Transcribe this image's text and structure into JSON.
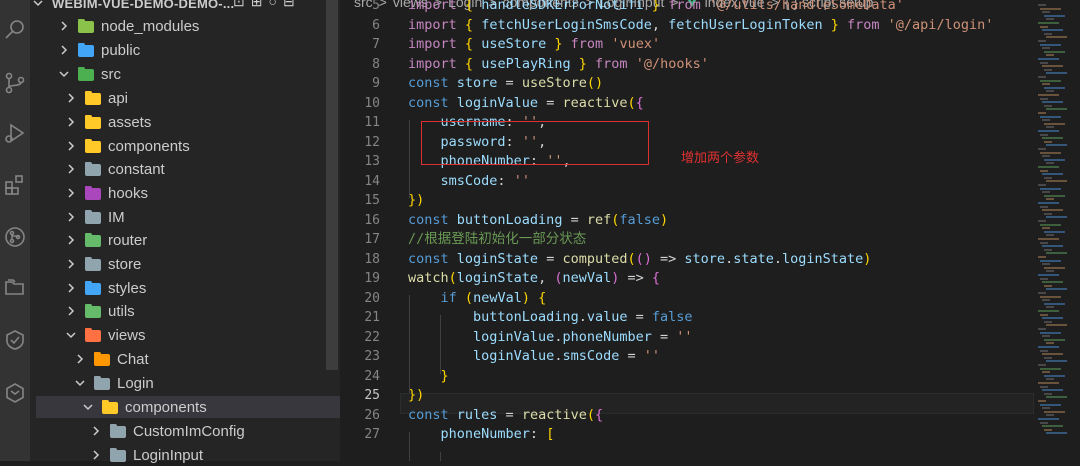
{
  "explorer": {
    "title": "WEBIM-VUE-DEMO-DEMO-...",
    "tree": [
      {
        "label": "node_modules",
        "icon": "node-modules-folder-icon",
        "expanded": false,
        "color": "#8bc34a"
      },
      {
        "label": "public",
        "icon": "public-folder-icon",
        "expanded": false,
        "color": "#42a5f5"
      },
      {
        "label": "src",
        "icon": "src-folder-icon",
        "expanded": true,
        "color": "#4caf50"
      },
      {
        "label": "api",
        "icon": "api-folder-icon",
        "expanded": false,
        "color": "#ffca28"
      },
      {
        "label": "assets",
        "icon": "assets-folder-icon",
        "expanded": false,
        "color": "#ffca28"
      },
      {
        "label": "components",
        "icon": "components-folder-icon",
        "expanded": false,
        "color": "#ffca28"
      },
      {
        "label": "constant",
        "icon": "constant-folder-icon",
        "expanded": false,
        "color": "#90a4ae"
      },
      {
        "label": "hooks",
        "icon": "hooks-folder-icon",
        "expanded": false,
        "color": "#ab47bc"
      },
      {
        "label": "IM",
        "icon": "folder-icon",
        "expanded": false,
        "color": "#90a4ae"
      },
      {
        "label": "router",
        "icon": "router-folder-icon",
        "expanded": false,
        "color": "#66bb6a"
      },
      {
        "label": "store",
        "icon": "store-folder-icon",
        "expanded": false,
        "color": "#90a4ae"
      },
      {
        "label": "styles",
        "icon": "styles-folder-icon",
        "expanded": false,
        "color": "#42a5f5"
      },
      {
        "label": "utils",
        "icon": "utils-folder-icon",
        "expanded": false,
        "color": "#66bb6a"
      },
      {
        "label": "views",
        "icon": "views-folder-icon",
        "expanded": true,
        "color": "#ff7043"
      },
      {
        "label": "Chat",
        "icon": "folder-icon",
        "expanded": false,
        "color": "#ff9800"
      },
      {
        "label": "Login",
        "icon": "folder-icon",
        "expanded": true,
        "color": "#90a4ae"
      },
      {
        "label": "components",
        "icon": "components-folder-icon",
        "expanded": true,
        "color": "#ffca28"
      },
      {
        "label": "CustomImConfig",
        "icon": "folder-icon",
        "expanded": false,
        "color": "#90a4ae"
      },
      {
        "label": "LoginInput",
        "icon": "folder-icon",
        "expanded": false,
        "color": "#90a4ae"
      }
    ]
  },
  "breadcrumb": {
    "parts": [
      "src",
      "views",
      "Login",
      "components",
      "LoginInput",
      "index.vue",
      "{ } script setup"
    ],
    "sep": ">"
  },
  "editor": {
    "active_line": 25,
    "annotation": "增加两个参数",
    "lines": [
      {
        "n": "5",
        "text": "import { handleSDKErrorNotifi } from '@/utils/handleSomeData'"
      },
      {
        "n": "6",
        "text": "import { fetchUserLoginSmsCode, fetchUserLoginToken } from '@/api/login'"
      },
      {
        "n": "7",
        "text": "import { useStore } from 'vuex'"
      },
      {
        "n": "8",
        "text": "import { usePlayRing } from '@/hooks'"
      },
      {
        "n": "9",
        "text": "const store = useStore()"
      },
      {
        "n": "10",
        "text": "const loginValue = reactive({"
      },
      {
        "n": "11",
        "text": "    username: '',"
      },
      {
        "n": "12",
        "text": "    password: '',"
      },
      {
        "n": "13",
        "text": "    phoneNumber: '',"
      },
      {
        "n": "14",
        "text": "    smsCode: ''"
      },
      {
        "n": "15",
        "text": "})"
      },
      {
        "n": "16",
        "text": "const buttonLoading = ref(false)"
      },
      {
        "n": "17",
        "text": "//根据登陆初始化一部分状态"
      },
      {
        "n": "18",
        "text": "const loginState = computed(() => store.state.loginState)"
      },
      {
        "n": "19",
        "text": "watch(loginState, (newVal) => {"
      },
      {
        "n": "20",
        "text": "    if (newVal) {"
      },
      {
        "n": "21",
        "text": "        buttonLoading.value = false"
      },
      {
        "n": "22",
        "text": "        loginValue.phoneNumber = ''"
      },
      {
        "n": "23",
        "text": "        loginValue.smsCode = ''"
      },
      {
        "n": "24",
        "text": "    }"
      },
      {
        "n": "25",
        "text": "})"
      },
      {
        "n": "26",
        "text": "const rules = reactive({"
      },
      {
        "n": "27",
        "text": "    phoneNumber: ["
      }
    ]
  }
}
